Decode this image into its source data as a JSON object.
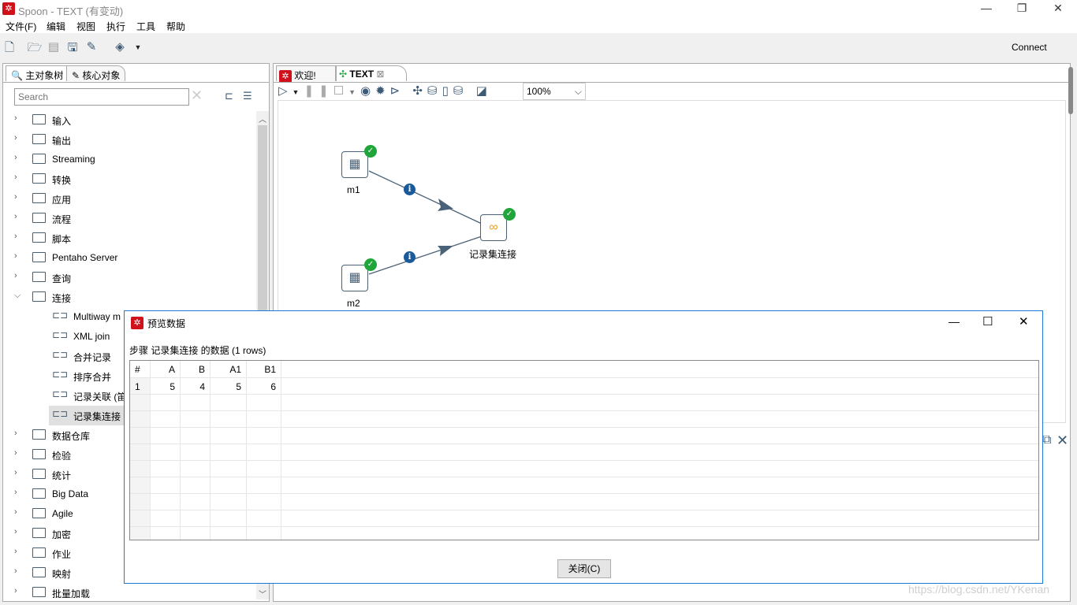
{
  "window": {
    "title": "Spoon - TEXT (有变动)",
    "minimize": "—",
    "restore": "❐",
    "close": "✕"
  },
  "menu": [
    "文件(F)",
    "编辑",
    "视图",
    "执行",
    "工具",
    "帮助"
  ],
  "toolbar": {
    "connect": "Connect",
    "icons": [
      "new-file-icon",
      "open-icon",
      "explore-icon",
      "save-icon",
      "save-as-icon",
      "layers-icon"
    ]
  },
  "left": {
    "tabs": [
      "主对象树",
      "核心对象"
    ],
    "search_placeholder": "Search",
    "tree": [
      {
        "label": "输入",
        "type": "folder",
        "state": "collapsed"
      },
      {
        "label": "输出",
        "type": "folder",
        "state": "collapsed"
      },
      {
        "label": "Streaming",
        "type": "folder",
        "state": "collapsed"
      },
      {
        "label": "转换",
        "type": "folder",
        "state": "collapsed"
      },
      {
        "label": "应用",
        "type": "folder",
        "state": "collapsed"
      },
      {
        "label": "流程",
        "type": "folder",
        "state": "collapsed"
      },
      {
        "label": "脚本",
        "type": "folder",
        "state": "collapsed"
      },
      {
        "label": "Pentaho Server",
        "type": "folder",
        "state": "collapsed"
      },
      {
        "label": "查询",
        "type": "folder",
        "state": "collapsed"
      },
      {
        "label": "连接",
        "type": "folder",
        "state": "expanded"
      },
      {
        "label": "Multiway m",
        "type": "step"
      },
      {
        "label": "XML join",
        "type": "step"
      },
      {
        "label": "合并记录",
        "type": "step"
      },
      {
        "label": "排序合并",
        "type": "step"
      },
      {
        "label": "记录关联 (笛",
        "type": "step"
      },
      {
        "label": "记录集连接",
        "type": "step",
        "selected": true
      },
      {
        "label": "数据仓库",
        "type": "folder",
        "state": "collapsed"
      },
      {
        "label": "检验",
        "type": "folder",
        "state": "collapsed"
      },
      {
        "label": "统计",
        "type": "folder",
        "state": "collapsed"
      },
      {
        "label": "Big Data",
        "type": "folder",
        "state": "collapsed"
      },
      {
        "label": "Agile",
        "type": "folder",
        "state": "collapsed"
      },
      {
        "label": "加密",
        "type": "folder",
        "state": "collapsed"
      },
      {
        "label": "作业",
        "type": "folder",
        "state": "collapsed"
      },
      {
        "label": "映射",
        "type": "folder",
        "state": "collapsed"
      },
      {
        "label": "批量加载",
        "type": "folder",
        "state": "collapsed"
      }
    ]
  },
  "right": {
    "tabs": [
      "欢迎!",
      "TEXT"
    ],
    "zoom": "100%",
    "steps": {
      "m1": "m1",
      "m2": "m2",
      "join": "记录集连接"
    }
  },
  "dialog": {
    "title": "预览数据",
    "subtitle": "步骤 记录集连接 的数据  (1 rows)",
    "columns": [
      "#",
      "A",
      "B",
      "A1",
      "B1"
    ],
    "rows": [
      [
        "1",
        "5",
        "4",
        "5",
        "6"
      ]
    ],
    "close": "关闭(C)"
  },
  "watermark": "https://blog.csdn.net/YKenan"
}
